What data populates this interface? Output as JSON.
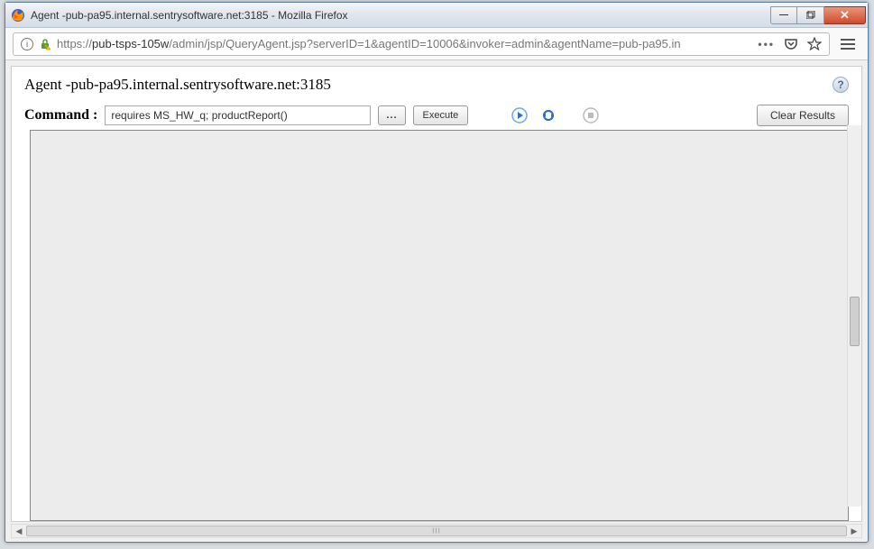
{
  "window": {
    "title": "Agent -pub-pa95.internal.sentrysoftware.net:3185 - Mozilla Firefox"
  },
  "addressbar": {
    "url_prefix": "https://",
    "url_host": "pub-tsps-105w",
    "url_path": "/admin/jsp/QueryAgent.jsp?serverID=1&agentID=10006&invoker=admin&agentName=pub-pa95.in"
  },
  "page": {
    "title": "Agent -pub-pa95.internal.sentrysoftware.net:3185"
  },
  "toolbar": {
    "command_label": "Command :",
    "command_value": "requires MS_HW_q; productReport()",
    "browse_label": "...",
    "execute_label": "Execute",
    "clear_label": "Clear Results"
  }
}
